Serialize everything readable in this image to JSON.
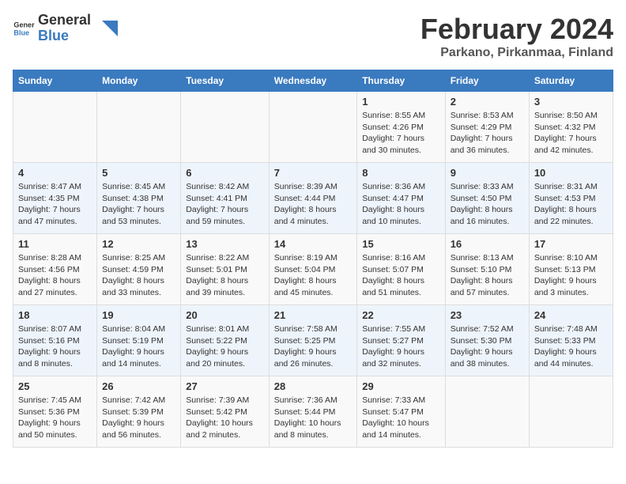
{
  "logo": {
    "text_general": "General",
    "text_blue": "Blue"
  },
  "header": {
    "title": "February 2024",
    "subtitle": "Parkano, Pirkanmaa, Finland"
  },
  "weekdays": [
    "Sunday",
    "Monday",
    "Tuesday",
    "Wednesday",
    "Thursday",
    "Friday",
    "Saturday"
  ],
  "weeks": [
    [
      {
        "day": "",
        "info": ""
      },
      {
        "day": "",
        "info": ""
      },
      {
        "day": "",
        "info": ""
      },
      {
        "day": "",
        "info": ""
      },
      {
        "day": "1",
        "info": "Sunrise: 8:55 AM\nSunset: 4:26 PM\nDaylight: 7 hours\nand 30 minutes."
      },
      {
        "day": "2",
        "info": "Sunrise: 8:53 AM\nSunset: 4:29 PM\nDaylight: 7 hours\nand 36 minutes."
      },
      {
        "day": "3",
        "info": "Sunrise: 8:50 AM\nSunset: 4:32 PM\nDaylight: 7 hours\nand 42 minutes."
      }
    ],
    [
      {
        "day": "4",
        "info": "Sunrise: 8:47 AM\nSunset: 4:35 PM\nDaylight: 7 hours\nand 47 minutes."
      },
      {
        "day": "5",
        "info": "Sunrise: 8:45 AM\nSunset: 4:38 PM\nDaylight: 7 hours\nand 53 minutes."
      },
      {
        "day": "6",
        "info": "Sunrise: 8:42 AM\nSunset: 4:41 PM\nDaylight: 7 hours\nand 59 minutes."
      },
      {
        "day": "7",
        "info": "Sunrise: 8:39 AM\nSunset: 4:44 PM\nDaylight: 8 hours\nand 4 minutes."
      },
      {
        "day": "8",
        "info": "Sunrise: 8:36 AM\nSunset: 4:47 PM\nDaylight: 8 hours\nand 10 minutes."
      },
      {
        "day": "9",
        "info": "Sunrise: 8:33 AM\nSunset: 4:50 PM\nDaylight: 8 hours\nand 16 minutes."
      },
      {
        "day": "10",
        "info": "Sunrise: 8:31 AM\nSunset: 4:53 PM\nDaylight: 8 hours\nand 22 minutes."
      }
    ],
    [
      {
        "day": "11",
        "info": "Sunrise: 8:28 AM\nSunset: 4:56 PM\nDaylight: 8 hours\nand 27 minutes."
      },
      {
        "day": "12",
        "info": "Sunrise: 8:25 AM\nSunset: 4:59 PM\nDaylight: 8 hours\nand 33 minutes."
      },
      {
        "day": "13",
        "info": "Sunrise: 8:22 AM\nSunset: 5:01 PM\nDaylight: 8 hours\nand 39 minutes."
      },
      {
        "day": "14",
        "info": "Sunrise: 8:19 AM\nSunset: 5:04 PM\nDaylight: 8 hours\nand 45 minutes."
      },
      {
        "day": "15",
        "info": "Sunrise: 8:16 AM\nSunset: 5:07 PM\nDaylight: 8 hours\nand 51 minutes."
      },
      {
        "day": "16",
        "info": "Sunrise: 8:13 AM\nSunset: 5:10 PM\nDaylight: 8 hours\nand 57 minutes."
      },
      {
        "day": "17",
        "info": "Sunrise: 8:10 AM\nSunset: 5:13 PM\nDaylight: 9 hours\nand 3 minutes."
      }
    ],
    [
      {
        "day": "18",
        "info": "Sunrise: 8:07 AM\nSunset: 5:16 PM\nDaylight: 9 hours\nand 8 minutes."
      },
      {
        "day": "19",
        "info": "Sunrise: 8:04 AM\nSunset: 5:19 PM\nDaylight: 9 hours\nand 14 minutes."
      },
      {
        "day": "20",
        "info": "Sunrise: 8:01 AM\nSunset: 5:22 PM\nDaylight: 9 hours\nand 20 minutes."
      },
      {
        "day": "21",
        "info": "Sunrise: 7:58 AM\nSunset: 5:25 PM\nDaylight: 9 hours\nand 26 minutes."
      },
      {
        "day": "22",
        "info": "Sunrise: 7:55 AM\nSunset: 5:27 PM\nDaylight: 9 hours\nand 32 minutes."
      },
      {
        "day": "23",
        "info": "Sunrise: 7:52 AM\nSunset: 5:30 PM\nDaylight: 9 hours\nand 38 minutes."
      },
      {
        "day": "24",
        "info": "Sunrise: 7:48 AM\nSunset: 5:33 PM\nDaylight: 9 hours\nand 44 minutes."
      }
    ],
    [
      {
        "day": "25",
        "info": "Sunrise: 7:45 AM\nSunset: 5:36 PM\nDaylight: 9 hours\nand 50 minutes."
      },
      {
        "day": "26",
        "info": "Sunrise: 7:42 AM\nSunset: 5:39 PM\nDaylight: 9 hours\nand 56 minutes."
      },
      {
        "day": "27",
        "info": "Sunrise: 7:39 AM\nSunset: 5:42 PM\nDaylight: 10 hours\nand 2 minutes."
      },
      {
        "day": "28",
        "info": "Sunrise: 7:36 AM\nSunset: 5:44 PM\nDaylight: 10 hours\nand 8 minutes."
      },
      {
        "day": "29",
        "info": "Sunrise: 7:33 AM\nSunset: 5:47 PM\nDaylight: 10 hours\nand 14 minutes."
      },
      {
        "day": "",
        "info": ""
      },
      {
        "day": "",
        "info": ""
      }
    ]
  ]
}
